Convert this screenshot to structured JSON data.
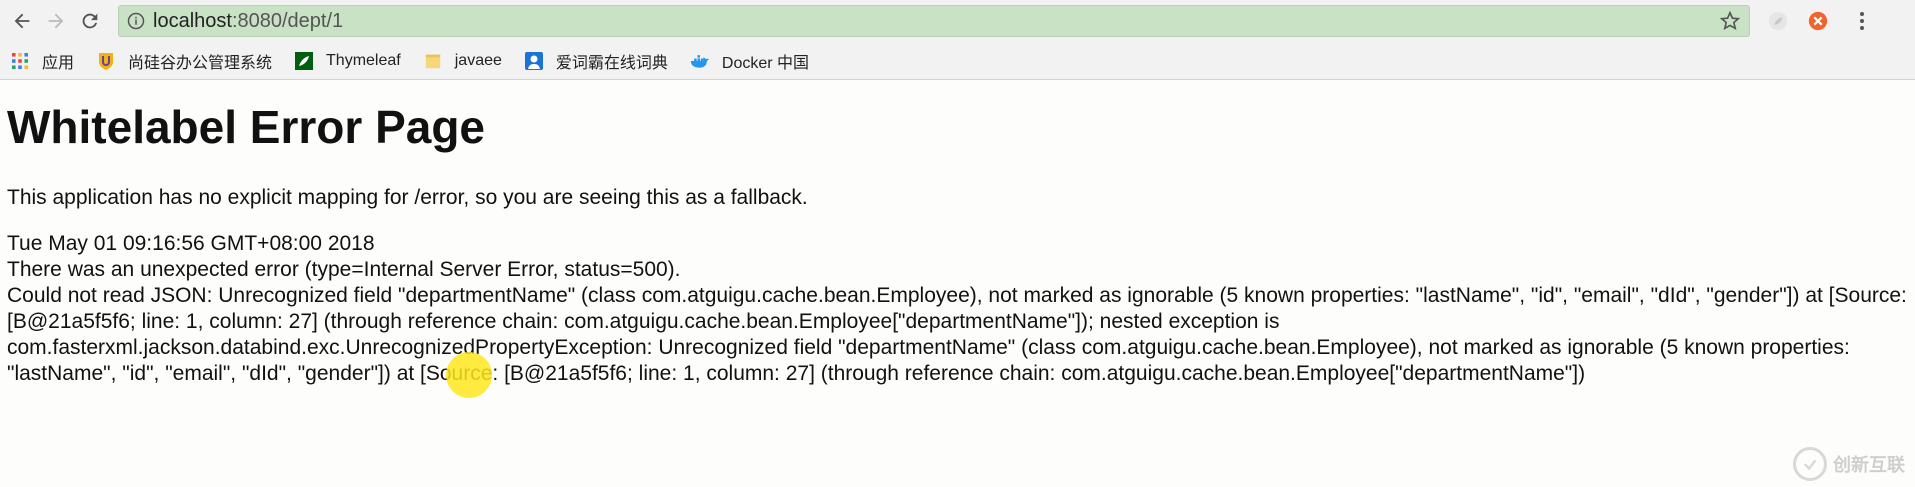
{
  "browser": {
    "url_host": "localhost",
    "url_rest": ":8080/dept/1"
  },
  "bookmarks": [
    {
      "label": "应用",
      "icon": "apps-grid-icon"
    },
    {
      "label": "尚硅谷办公管理系统",
      "icon": "shield-logo-icon"
    },
    {
      "label": "Thymeleaf",
      "icon": "thymeleaf-leaf-icon"
    },
    {
      "label": "javaee",
      "icon": "folder-icon"
    },
    {
      "label": "爱词霸在线词典",
      "icon": "dictionary-icon"
    },
    {
      "label": "Docker 中国",
      "icon": "docker-whale-icon"
    }
  ],
  "page": {
    "title": "Whitelabel Error Page",
    "lead": "This application has no explicit mapping for /error, so you are seeing this as a fallback.",
    "timestamp": "Tue May 01 09:16:56 GMT+08:00 2018",
    "error_line": "There was an unexpected error (type=Internal Server Error, status=500).",
    "message": "Could not read JSON: Unrecognized field \"departmentName\" (class com.atguigu.cache.bean.Employee), not marked as ignorable (5 known properties: \"lastName\", \"id\", \"email\", \"dId\", \"gender\"]) at [Source: [B@21a5f5f6; line: 1, column: 27] (through reference chain: com.atguigu.cache.bean.Employee[\"departmentName\"]); nested exception is com.fasterxml.jackson.databind.exc.UnrecognizedPropertyException: Unrecognized field \"departmentName\" (class com.atguigu.cache.bean.Employee), not marked as ignorable (5 known properties: \"lastName\", \"id\", \"email\", \"dId\", \"gender\"]) at [Source: [B@21a5f5f6; line: 1, column: 27] (through reference chain: com.atguigu.cache.bean.Employee[\"departmentName\"])"
  },
  "watermark": {
    "text": "创新互联"
  },
  "colors": {
    "omnibox_bg": "#c9e2c6",
    "cursor_highlight": "#ffe61e"
  }
}
